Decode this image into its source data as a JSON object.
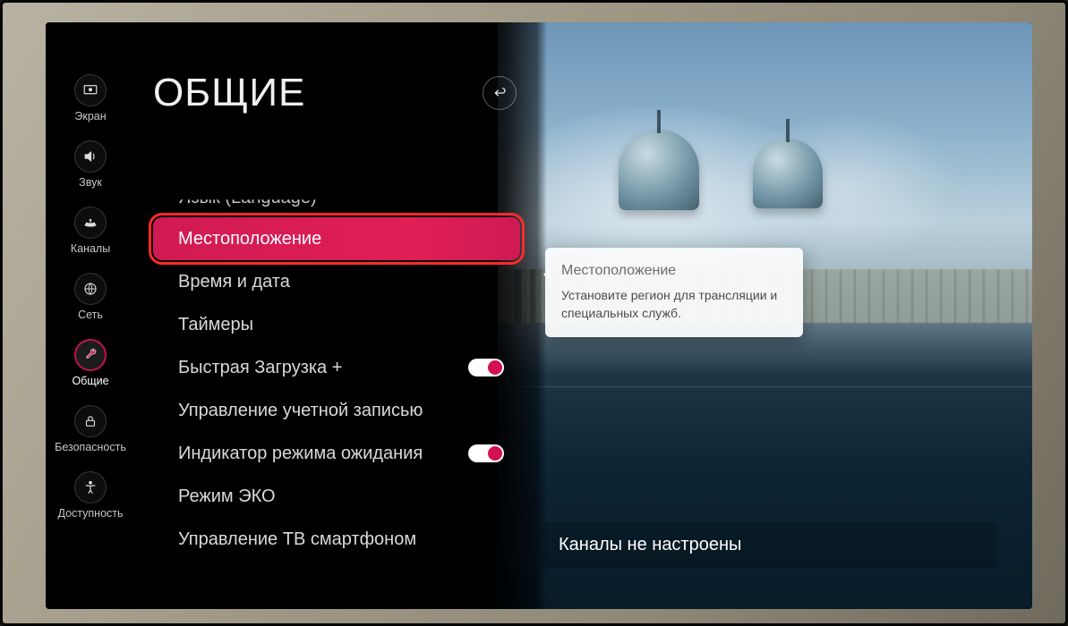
{
  "page_title": "ОБЩИЕ",
  "sidebar": {
    "items": [
      {
        "label": "Экран"
      },
      {
        "label": "Звук"
      },
      {
        "label": "Каналы"
      },
      {
        "label": "Сеть"
      },
      {
        "label": "Общие"
      },
      {
        "label": "Безопасность"
      },
      {
        "label": "Доступность"
      }
    ]
  },
  "menu": {
    "items": [
      {
        "label": "Язык (Language)"
      },
      {
        "label": "Местоположение"
      },
      {
        "label": "Время и дата"
      },
      {
        "label": "Таймеры"
      },
      {
        "label": "Быстрая Загрузка +",
        "toggle": true
      },
      {
        "label": "Управление учетной записью"
      },
      {
        "label": "Индикатор режима ожидания",
        "toggle": true
      },
      {
        "label": "Режим ЭКО"
      },
      {
        "label": "Управление ТВ смартфоном"
      }
    ]
  },
  "tooltip": {
    "title": "Местоположение",
    "body": "Установите регион для трансляции и специальных служб."
  },
  "status_text": "Каналы не настроены"
}
